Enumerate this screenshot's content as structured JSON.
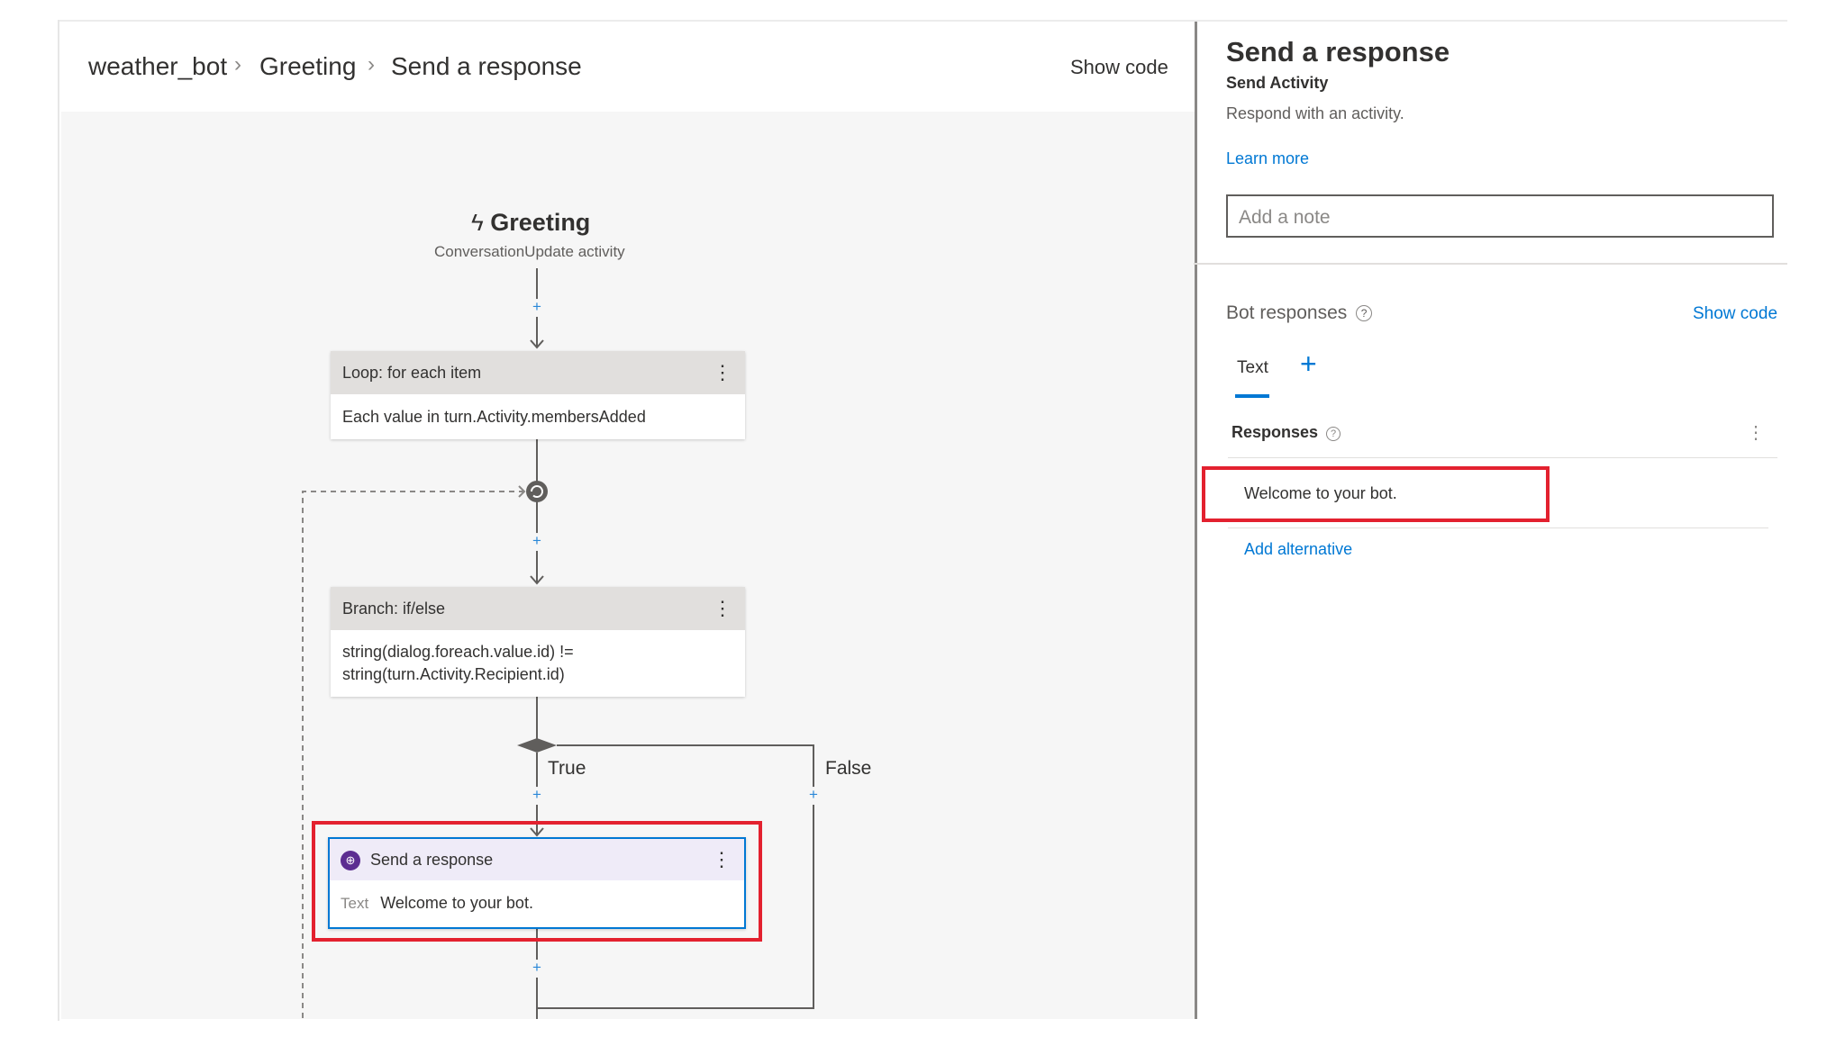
{
  "breadcrumb": {
    "items": [
      "weather_bot",
      "Greeting",
      "Send a response"
    ],
    "separator": ">",
    "show_code": "Show code"
  },
  "trigger": {
    "title": "Greeting",
    "subtitle": "ConversationUpdate activity",
    "icon": "lightning-icon"
  },
  "nodes": {
    "loop": {
      "header": "Loop: for each item",
      "body": "Each value in turn.Activity.membersAdded"
    },
    "branch": {
      "header": "Branch: if/else",
      "body_line1": "string(dialog.foreach.value.id) !=",
      "body_line2": "string(turn.Activity.Recipient.id)"
    },
    "send": {
      "header": "Send a response",
      "body_label": "Text",
      "body_value": "Welcome to your bot."
    }
  },
  "branch_labels": {
    "true_label": "True",
    "false_label": "False"
  },
  "panel": {
    "title": "Send a response",
    "subtitle": "Send Activity",
    "description": "Respond with an activity.",
    "learn_more": "Learn more",
    "note_placeholder": "Add a note",
    "bot_responses_label": "Bot responses",
    "show_code": "Show code",
    "tabs": [
      "Text"
    ],
    "responses_label": "Responses",
    "response_items": [
      "Welcome to your bot."
    ],
    "add_alternative": "Add alternative"
  },
  "colors": {
    "accent": "#0078d4",
    "highlight": "#e3212f",
    "node_header": "#e1dfdd",
    "send_header": "#efebf8",
    "send_icon": "#5c2d91"
  }
}
